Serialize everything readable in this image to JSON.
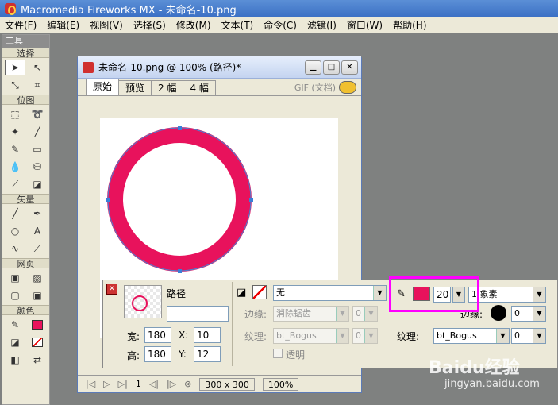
{
  "app": {
    "title": "Macromedia Fireworks MX - 未命名-10.png"
  },
  "menu": [
    "文件(F)",
    "编辑(E)",
    "视图(V)",
    "选择(S)",
    "修改(M)",
    "文本(T)",
    "命令(C)",
    "滤镜(I)",
    "窗口(W)",
    "帮助(H)"
  ],
  "tools": {
    "header": "工具",
    "sections": {
      "select": "选择",
      "bitmap": "位图",
      "vector": "矢量",
      "web": "网页",
      "colors": "颜色"
    }
  },
  "document": {
    "title": "未命名-10.png @ 100% (路径)*",
    "tabs": [
      "原始",
      "预览",
      "2 幅",
      "4 幅"
    ],
    "export_format": "GIF (文档)",
    "frame": "1",
    "size": "300 x 300",
    "zoom": "100%"
  },
  "properties": {
    "object_type": "路径",
    "width_label": "宽:",
    "width": "180",
    "height_label": "高:",
    "height": "180",
    "x_label": "X:",
    "x": "10",
    "y_label": "Y:",
    "y": "12",
    "fill_value": "无",
    "edge_label": "边缘:",
    "edge_value": "消除锯齿",
    "edge_num": "0",
    "texture_label": "纹理:",
    "texture_value": "bt_Bogus",
    "texture_num": "0",
    "transparent_label": "透明",
    "stroke_size": "20",
    "stroke_type": "1 象素",
    "stroke_edge_label": "边缘:",
    "stroke_edge_num": "0",
    "stroke_texture_label": "纹理:",
    "stroke_texture_value": "bt_Bogus",
    "stroke_texture_num": "0"
  },
  "colors": {
    "stroke": "#e8125c",
    "accent_highlight": "#ff00ff"
  },
  "watermark": {
    "brand": "Baidu经验",
    "url": "jingyan.baidu.com"
  }
}
